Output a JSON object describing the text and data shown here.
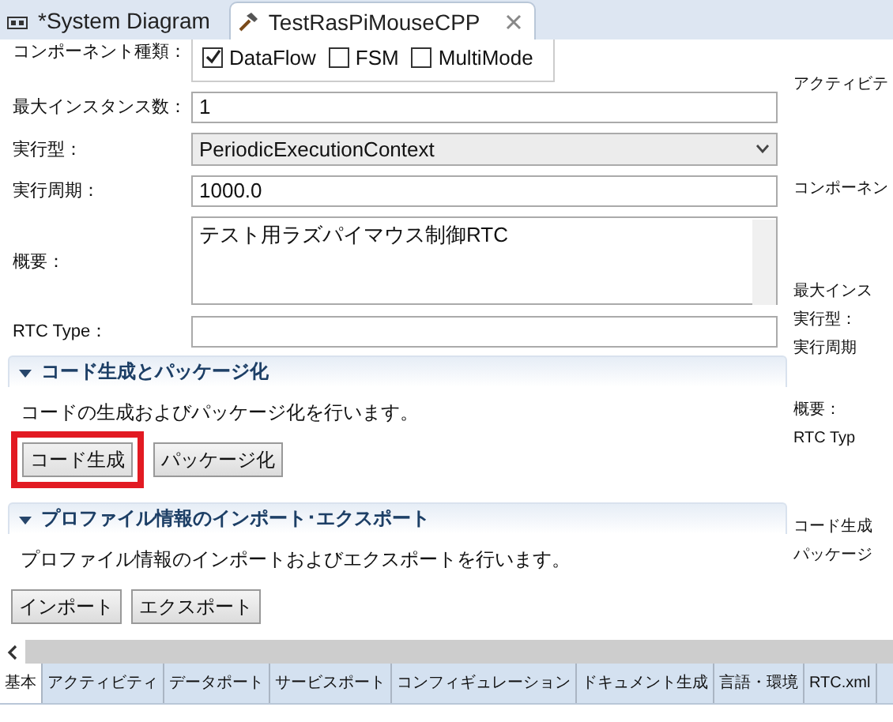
{
  "editor_tabs": [
    {
      "label": "*System Diagram",
      "selected": false
    },
    {
      "label": "TestRasPiMouseCPP",
      "selected": true
    }
  ],
  "component_type": {
    "label": "コンポーネント種類：",
    "options": [
      {
        "label": "DataFlow",
        "checked": true
      },
      {
        "label": "FSM",
        "checked": false
      },
      {
        "label": "MultiMode",
        "checked": false
      }
    ]
  },
  "fields": [
    {
      "kind": "text",
      "label": "最大インスタンス数：",
      "value": "1"
    },
    {
      "kind": "select",
      "label": "実行型：",
      "value": "PeriodicExecutionContext"
    },
    {
      "kind": "text",
      "label": "実行周期：",
      "value": "1000.0"
    },
    {
      "kind": "textarea",
      "label": "概要：",
      "value": "テスト用ラズパイマウス制御RTC"
    },
    {
      "kind": "text",
      "label": "RTC Type："
    }
  ],
  "sections": [
    {
      "title": "コード生成とパッケージ化",
      "expanded": true,
      "description": "コードの生成およびパッケージ化を行います。",
      "buttons": [
        {
          "label": "コード生成",
          "highlighted": true
        },
        {
          "label": "パッケージ化",
          "highlighted": false
        }
      ]
    },
    {
      "title": "プロファイル情報のインポート･エクスポート",
      "expanded": true,
      "description": "プロファイル情報のインポートおよびエクスポートを行います。",
      "buttons": [
        {
          "label": "インポート",
          "highlighted": false
        },
        {
          "label": "エクスポート",
          "highlighted": false
        }
      ]
    }
  ],
  "side_panel": [
    [
      "アクティビテ"
    ],
    [
      "コンポーネン"
    ],
    [
      "最大インス",
      "実行型：",
      "実行周期"
    ],
    [
      "概要：",
      "RTC Typ"
    ],
    [
      "コード生成",
      "パッケージ"
    ]
  ],
  "bottom_tabs": [
    {
      "label": "基本",
      "selected": true
    },
    {
      "label": "アクティビティ",
      "selected": false
    },
    {
      "label": "データポート",
      "selected": false
    },
    {
      "label": "サービスポート",
      "selected": false
    },
    {
      "label": "コンフィギュレーション",
      "selected": false
    },
    {
      "label": "ドキュメント生成",
      "selected": false
    },
    {
      "label": "言語・環境",
      "selected": false
    },
    {
      "label": "RTC.xml",
      "selected": false
    }
  ]
}
